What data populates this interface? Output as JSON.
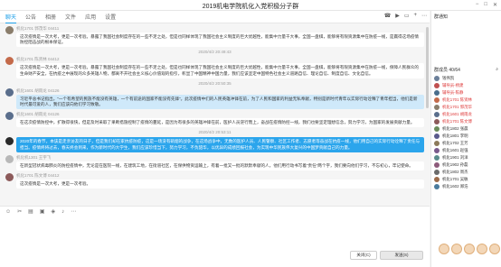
{
  "window": {
    "title": "2019机电学院机化入党积极分子群"
  },
  "tabs": [
    "聊天",
    "公告",
    "相册",
    "文件",
    "应用",
    "设置"
  ],
  "chat": {
    "messages": [
      {
        "time": "",
        "sender": "机化1701 郭茂华 04411",
        "text": "这次疫情是一次大考，更是一次考验。暴露了我国社会制度存在的一些不足之处，但是也同样体现了我国社会主义制度的巨大优越性，能集中力量干大事，全国一盘棋，能够将有限资源集中在防疫一线，是赢得这场疫情防控阻击战的根本保证。",
        "style": "plain",
        "avatar": "#8a7d6b"
      },
      {
        "time": "2020/4/2 20:49:43",
        "sender": "机化1701 陈贤林 04412",
        "text": "这次疫情是一次大考，更是一次考验。暴露了我国社会制度存在的一些不足之处，但是也同样体现了我国社会主义制度的巨大优越性，能集中力量干大事，全国一盘棋，能够将有限资源集中在防疫一线，保障人民群众的生命财产安全，在抗疫之中展现的众多英雄人物，都离不开社会主义核心价值观的指引，彰显了中国精神中国力量，我们应该坚定中国特色社会主义道路自信、理论自信、制度自信、文化自信。",
        "style": "plain",
        "avatar": "#c46a4a"
      },
      {
        "time": "2020/4/2 20:50:35",
        "sender": "机化1601 胡雨龙 04126",
        "text": "习近平总书记指出，“一个有希望的民族不能没有英雄，一个有前途的国家不能没有先锋”。此次疫情中们的人民英雄冲锋在前，为了人民和国家的利益无私奉献，特别是新时代青年以实际行动诠释了青年担当，他们是新时代最可爱的人，我们应该向他们学习致敬。",
        "style": "blue",
        "avatar": "#5a6e8c"
      },
      {
        "time": "",
        "sender": "机化1601 胡雨龙 04126",
        "text": "在这次疫情防控中，扩散得很快，但是及时采取了果断措施控制了疫情的蔓延，是因为有很多的英雄冲锋在前，医护人员逆行而上，奋战在疫情防控一线，我们也要坚定理想信念，努力学习，为国家的发展贡献力量。",
        "style": "plain",
        "avatar": "#5a6e8c"
      },
      {
        "time": "2020/4/2 20:53:11",
        "sender": "",
        "text": "2020年的春节，本该是走亲访友的日子，但是我们却在家抗疫防疫，这是一场没有硝烟的战争，在这场战争中，无数的医护人员、人民警察、社区工作者、志愿者等奋战在抗疫一线，他们用自己的实际行动诠释了责任与担当。疫情终将过去，春天终会到来，作为新时代的大学生，我们应该珍惜当下，努力学习，不负韶华，以优异的成绩回报社会，为实现中华民族伟大复兴的中国梦贡献自己的力量。",
        "style": "strong",
        "avatar": "#2a2a2a"
      },
      {
        "time": "",
        "sender": "机化机1301 王宇飞",
        "text": "在新型冠状病毒肺炎的防控疫情中，无论是在医院一线，在建筑工地，在街道社区，在保供物资运输上，有着一批又一批的默默奉献的人，他们用行动书写着“责任”两个字，我们要向他们学习，不忘初心，牢记使命。",
        "style": "plain",
        "avatar": "#b8b8b8"
      },
      {
        "time": "",
        "sender": "机化1701 陈文博 04412",
        "text": "这次疫情是一次大考，更是一次考验。",
        "style": "plain",
        "avatar": "#8c5a5a"
      }
    ]
  },
  "toolbar_icons": [
    "emoji-icon",
    "scissors-icon",
    "folder-icon",
    "image-icon",
    "gift-icon",
    "voice-icon",
    "more-icon"
  ],
  "buttons": {
    "close": "关闭(C)",
    "send": "发送(S)"
  },
  "sidebar": {
    "notice_title": "群通知",
    "notice_text": "",
    "members_title": "群成员 40/64",
    "members": [
      {
        "name": "钱伟凯",
        "color": "#6b7f99",
        "red": false
      },
      {
        "name": "辅导员-杨建",
        "color": "#c05050",
        "red": true
      },
      {
        "name": "辅导员-陈静",
        "color": "#4a6e8c",
        "red": true
      },
      {
        "name": "机化1701 陈贤林",
        "color": "#c46a4a",
        "red": true
      },
      {
        "name": "机化1701 郭茂华",
        "color": "#8a7d6b",
        "red": true
      },
      {
        "name": "机化1601 胡雨龙",
        "color": "#5a6e8c",
        "red": true
      },
      {
        "name": "机化1701 陈文博",
        "color": "#8c5a5a",
        "red": true
      },
      {
        "name": "机化1802 张晨",
        "color": "#6a8c5a",
        "red": false
      },
      {
        "name": "机化1801 李明",
        "color": "#5a5a8c",
        "red": false
      },
      {
        "name": "机化1702 王芳",
        "color": "#8c7a5a",
        "red": false
      },
      {
        "name": "机化1601 赵强",
        "color": "#7a5a8c",
        "red": false
      },
      {
        "name": "机化1901 刘洋",
        "color": "#5a8c8c",
        "red": false
      },
      {
        "name": "机化1902 孙磊",
        "color": "#8c5a7a",
        "red": false
      },
      {
        "name": "机化1802 周杰",
        "color": "#6b6b6b",
        "red": false
      },
      {
        "name": "机化1701 吴敏",
        "color": "#9c6b4a",
        "red": false
      },
      {
        "name": "机化1602 郑浩",
        "color": "#4a7a9c",
        "red": false
      }
    ]
  }
}
